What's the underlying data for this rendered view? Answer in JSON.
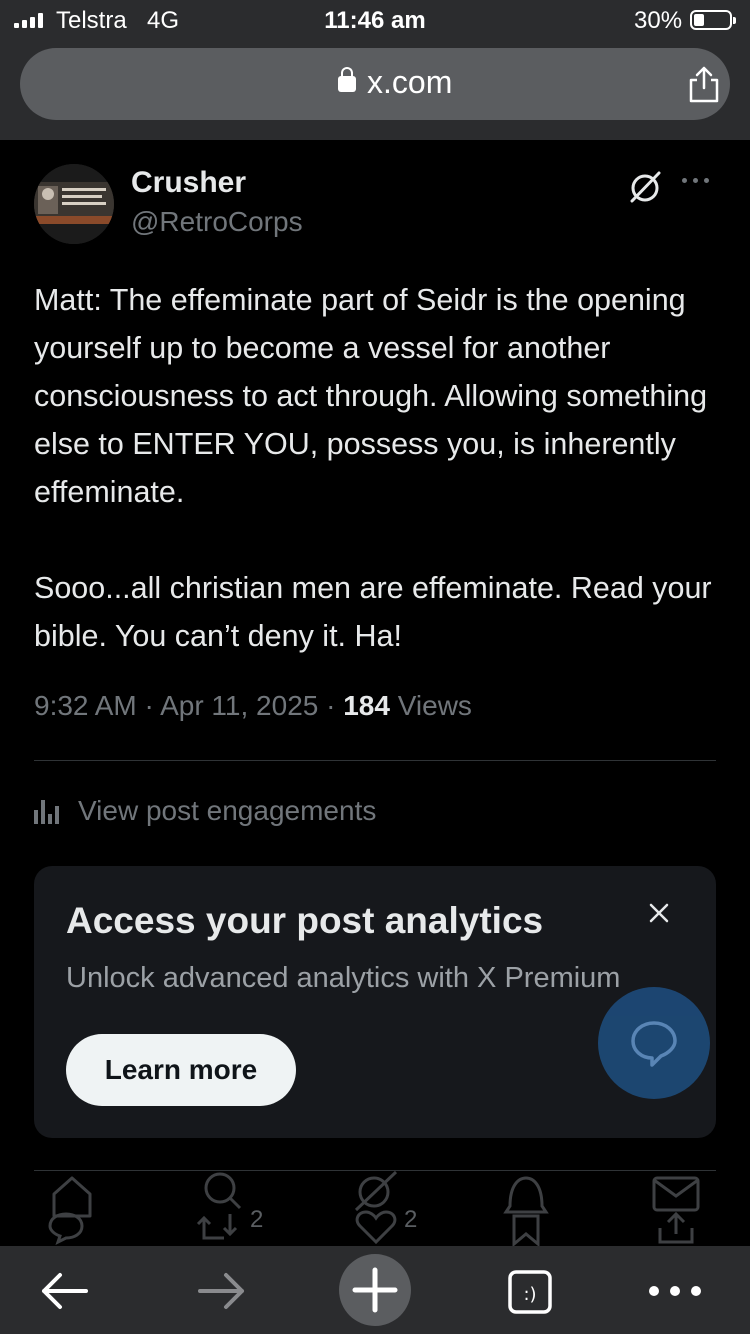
{
  "status_bar": {
    "carrier": "Telstra",
    "network": "4G",
    "time": "11:46 am",
    "battery_percent": "30%",
    "battery_level": 0.3
  },
  "browser": {
    "url": "x.com"
  },
  "post": {
    "author_name": "Crusher",
    "author_handle": "@RetroCorps",
    "text": "Matt: The effeminate part of Seidr is the opening yourself up to become a vessel for another consciousness to act through. Allowing something else to ENTER YOU, possess you, is inherently effeminate.\n\nSooo...all christian men are effeminate. Read your bible. You can’t deny it. Ha!",
    "time": "9:32 AM",
    "date": "Apr 11, 2025",
    "views_count": "184",
    "views_label": "Views",
    "engagements_label": "View post engagements"
  },
  "analytics_card": {
    "title": "Access your post analytics",
    "subtitle": "Unlock advanced analytics with X Premium",
    "button_label": "Learn more"
  },
  "post_actions": {
    "retweet_count": "2",
    "like_count": "2"
  },
  "colors": {
    "background": "#000000",
    "text_primary": "#e7e9ea",
    "text_secondary": "#71767b",
    "card_bg": "#16181c",
    "fab": "#1d4a78",
    "browser_chrome": "#2b2c2e"
  }
}
